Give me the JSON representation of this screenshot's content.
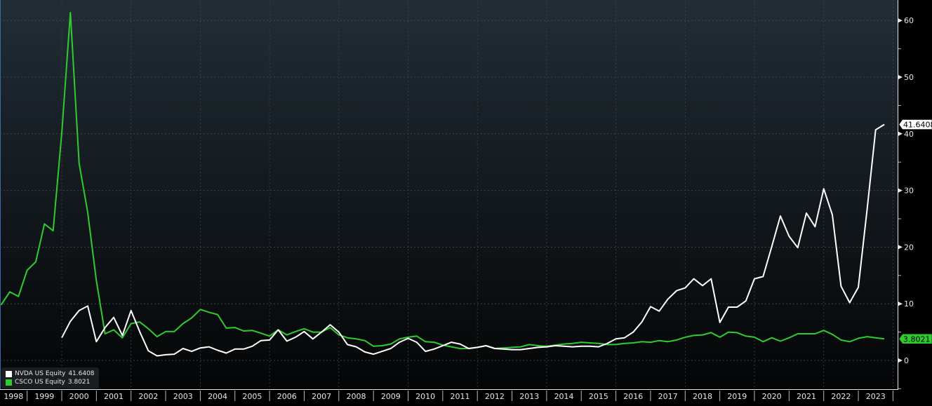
{
  "chart_data": {
    "type": "line",
    "title": "",
    "xlabel": "",
    "ylabel": "",
    "ylim": [
      -5,
      63.5
    ],
    "yticks": [
      0,
      10,
      20,
      30,
      40,
      50,
      60
    ],
    "xlim": [
      "1998-01",
      "2024-03"
    ],
    "x_tick_labels": [
      "1998",
      "1999",
      "2000",
      "2001",
      "2002",
      "2003",
      "2004",
      "2005",
      "2006",
      "2007",
      "2008",
      "2009",
      "2010",
      "2011",
      "2012",
      "2013",
      "2014",
      "2015",
      "2016",
      "2017",
      "2018",
      "2019",
      "2020",
      "2021",
      "2022",
      "2023"
    ],
    "grid": true,
    "legend_position": "bottom-left",
    "y_axis_side": "right",
    "x": [
      "1998-03",
      "1998-06",
      "1998-09",
      "1998-12",
      "1999-03",
      "1999-06",
      "1999-09",
      "1999-12",
      "2000-03",
      "2000-06",
      "2000-09",
      "2000-12",
      "2001-03",
      "2001-06",
      "2001-09",
      "2001-12",
      "2002-03",
      "2002-06",
      "2002-09",
      "2002-12",
      "2003-03",
      "2003-06",
      "2003-09",
      "2003-12",
      "2004-03",
      "2004-06",
      "2004-09",
      "2004-12",
      "2005-03",
      "2005-06",
      "2005-09",
      "2005-12",
      "2006-03",
      "2006-06",
      "2006-09",
      "2006-12",
      "2007-03",
      "2007-06",
      "2007-09",
      "2007-12",
      "2008-03",
      "2008-06",
      "2008-09",
      "2008-12",
      "2009-03",
      "2009-06",
      "2009-09",
      "2009-12",
      "2010-03",
      "2010-06",
      "2010-09",
      "2010-12",
      "2011-03",
      "2011-06",
      "2011-09",
      "2011-12",
      "2012-03",
      "2012-06",
      "2012-09",
      "2012-12",
      "2013-03",
      "2013-06",
      "2013-09",
      "2013-12",
      "2014-03",
      "2014-06",
      "2014-09",
      "2014-12",
      "2015-03",
      "2015-06",
      "2015-09",
      "2015-12",
      "2016-03",
      "2016-06",
      "2016-09",
      "2016-12",
      "2017-03",
      "2017-06",
      "2017-09",
      "2017-12",
      "2018-03",
      "2018-06",
      "2018-09",
      "2018-12",
      "2019-03",
      "2019-06",
      "2019-09",
      "2019-12",
      "2020-03",
      "2020-06",
      "2020-09",
      "2020-12",
      "2021-03",
      "2021-06",
      "2021-09",
      "2021-12",
      "2022-03",
      "2022-06",
      "2022-09",
      "2022-12",
      "2023-03",
      "2023-06",
      "2023-09"
    ],
    "series": [
      {
        "name": "NVDA US Equity",
        "last_value": "41.6408",
        "color": "#ffffff",
        "values": [
          null,
          null,
          null,
          null,
          null,
          null,
          null,
          4.0,
          6.9,
          8.8,
          9.6,
          3.3,
          5.8,
          7.6,
          4.4,
          8.8,
          5.1,
          1.7,
          0.8,
          1.0,
          1.1,
          2.1,
          1.6,
          2.2,
          2.4,
          1.8,
          1.3,
          2.0,
          2.0,
          2.5,
          3.5,
          3.6,
          5.4,
          3.4,
          4.1,
          5.1,
          3.8,
          5.0,
          6.3,
          5.0,
          2.8,
          2.4,
          1.5,
          1.1,
          1.6,
          2.1,
          3.2,
          3.9,
          3.2,
          1.6,
          2.0,
          2.6,
          3.2,
          2.9,
          2.1,
          2.3,
          2.6,
          2.1,
          2.0,
          1.9,
          1.9,
          2.1,
          2.3,
          2.4,
          2.6,
          2.5,
          2.4,
          2.5,
          2.5,
          2.4,
          3.0,
          3.8,
          4.0,
          5.0,
          6.8,
          9.5,
          8.7,
          10.8,
          12.3,
          12.8,
          14.4,
          13.2,
          14.4,
          6.7,
          9.4,
          9.4,
          10.5,
          14.4,
          14.8,
          20.1,
          25.5,
          21.9,
          19.9,
          26.0,
          23.6,
          30.3,
          25.7,
          13.1,
          10.2,
          12.9,
          26.5,
          40.7,
          41.6408
        ]
      },
      {
        "name": "CSCO US Equity",
        "last_value": "3.8021",
        "color": "#2ecc2e",
        "values": [
          9.8,
          12.1,
          11.3,
          15.9,
          17.4,
          24.1,
          22.9,
          40.1,
          61.4,
          34.8,
          26.1,
          14.1,
          4.7,
          5.4,
          4.0,
          6.5,
          6.8,
          5.6,
          4.2,
          5.1,
          5.1,
          6.5,
          7.5,
          9.0,
          8.5,
          8.1,
          5.7,
          5.8,
          5.2,
          5.3,
          4.8,
          4.3,
          5.4,
          4.5,
          5.1,
          5.6,
          5.0,
          5.0,
          5.8,
          4.5,
          4.0,
          3.8,
          3.5,
          2.5,
          2.6,
          2.9,
          3.8,
          4.1,
          4.3,
          3.3,
          3.2,
          2.7,
          2.4,
          2.1,
          2.1,
          2.3,
          2.6,
          2.1,
          2.2,
          2.3,
          2.4,
          2.8,
          2.6,
          2.5,
          2.7,
          2.9,
          3.0,
          3.2,
          3.1,
          3.0,
          2.8,
          2.8,
          3.0,
          3.1,
          3.3,
          3.2,
          3.5,
          3.3,
          3.6,
          4.1,
          4.4,
          4.5,
          4.9,
          4.1,
          5.0,
          4.9,
          4.3,
          4.1,
          3.3,
          4.0,
          3.4,
          4.0,
          4.7,
          4.7,
          4.7,
          5.3,
          4.6,
          3.6,
          3.3,
          3.9,
          4.2,
          4.0,
          3.8021
        ]
      }
    ]
  },
  "colors": {
    "background_top": "#222d36",
    "background_bottom": "#040506",
    "nvda": "#ffffff",
    "csco": "#2ecc2e"
  }
}
